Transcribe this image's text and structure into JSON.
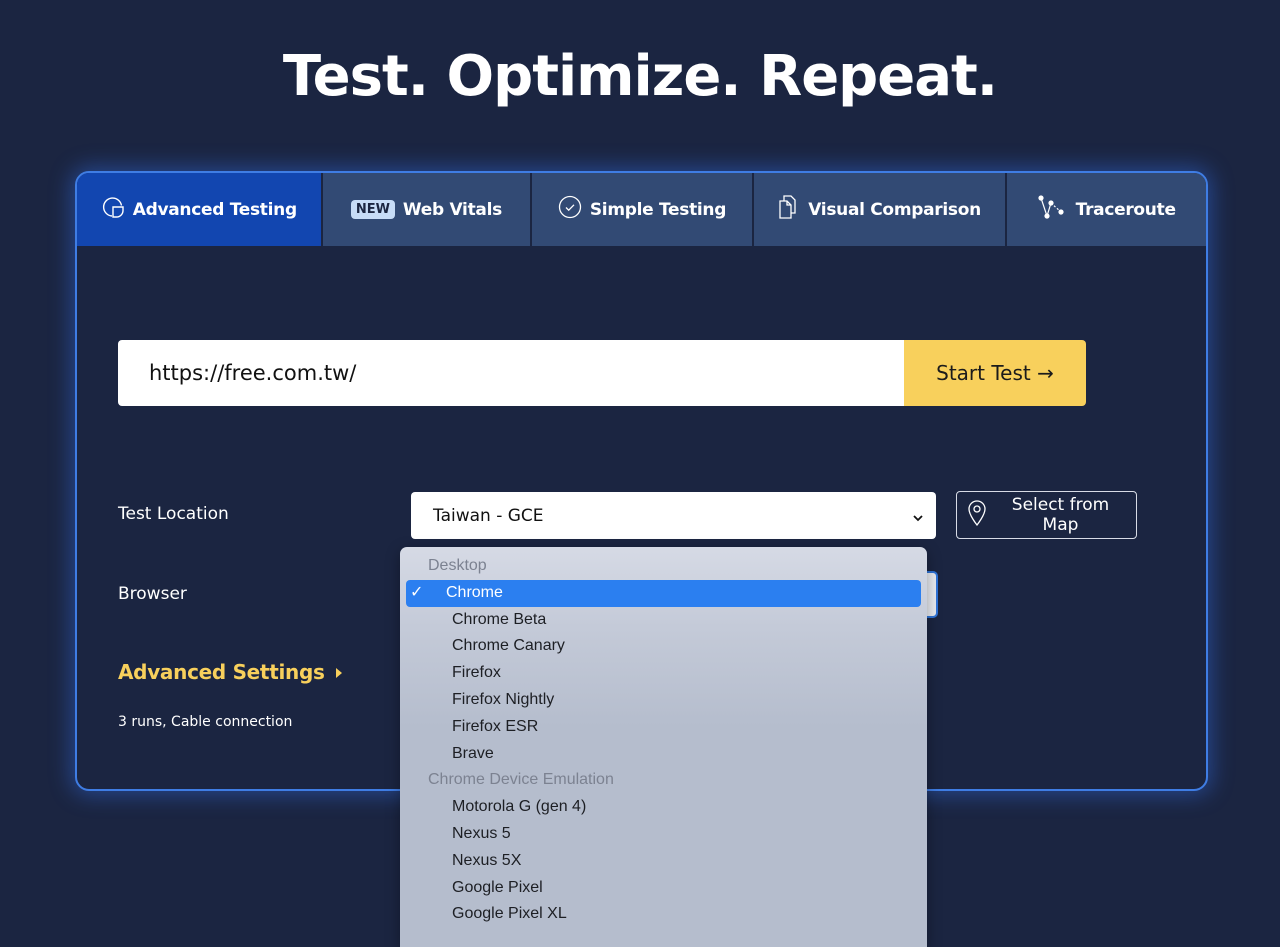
{
  "headline": "Test. Optimize. Repeat.",
  "colors": {
    "background": "#1b2541",
    "active_tab": "#1246b0",
    "tab": "#324a74",
    "accent_yellow": "#f8d05c",
    "panel_border": "#3f7de4",
    "selected_option": "#2b7ff0"
  },
  "tabs": [
    {
      "label": "Advanced Testing",
      "icon": "pie-chart-icon",
      "active": true
    },
    {
      "label": "Web Vitals",
      "badge": "NEW",
      "active": false
    },
    {
      "label": "Simple Testing",
      "icon": "check-circle-icon",
      "active": false
    },
    {
      "label": "Visual Comparison",
      "icon": "copy-pages-icon",
      "active": false
    },
    {
      "label": "Traceroute",
      "icon": "route-nodes-icon",
      "active": false
    }
  ],
  "url_input": {
    "value": "https://free.com.tw/"
  },
  "start_button": {
    "label": "Start Test →"
  },
  "test_location": {
    "label": "Test Location",
    "value": "Taiwan - GCE"
  },
  "map_button": {
    "label": "Select from Map",
    "icon": "map-pin-icon"
  },
  "browser": {
    "label": "Browser",
    "value": "Chrome"
  },
  "advanced_settings": {
    "label": "Advanced Settings",
    "summary": "3 runs, Cable connection"
  },
  "browser_dropdown": {
    "groups": [
      {
        "label": "Desktop",
        "options": [
          "Chrome",
          "Chrome Beta",
          "Chrome Canary",
          "Firefox",
          "Firefox Nightly",
          "Firefox ESR",
          "Brave"
        ]
      },
      {
        "label": "Chrome Device Emulation",
        "options": [
          "Motorola G (gen 4)",
          "Nexus 5",
          "Nexus 5X",
          "Google Pixel",
          "Google Pixel XL"
        ]
      }
    ],
    "selected": "Chrome",
    "check_mark": "✓"
  }
}
